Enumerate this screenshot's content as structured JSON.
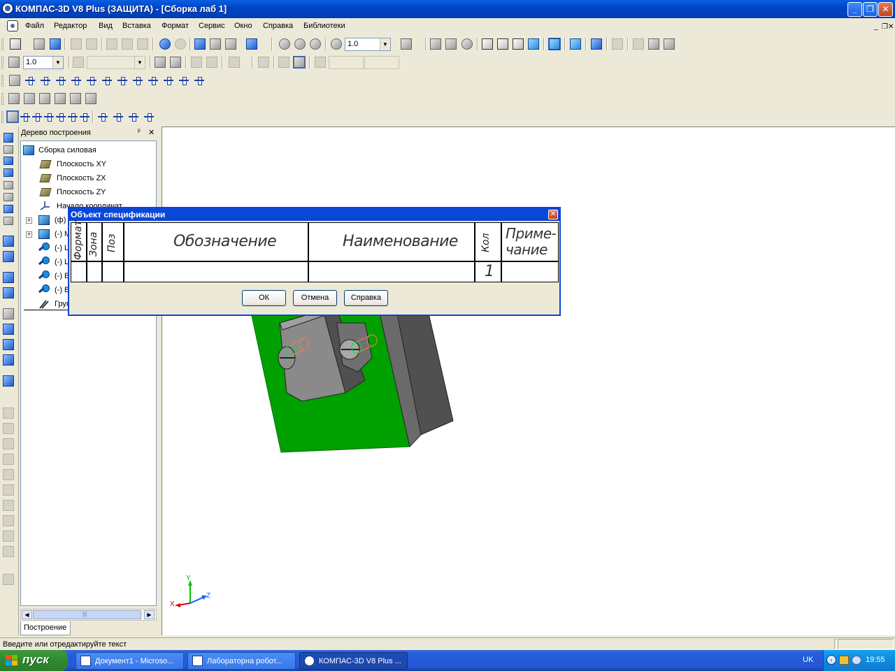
{
  "window": {
    "title": "КОМПАС-3D V8 Plus (ЗАЩИТА) - [Сборка лаб 1]",
    "minimize": "_",
    "restore": "❐",
    "close": "✕"
  },
  "menubar": {
    "items": [
      "Файл",
      "Редактор",
      "Вид",
      "Вставка",
      "Формат",
      "Сервис",
      "Окно",
      "Справка",
      "Библиотеки"
    ],
    "doc_controls": [
      "_",
      "❐",
      "✕"
    ]
  },
  "toolbar1": {
    "scale_value": "1.0"
  },
  "toolbar2": {
    "step_value": "1.0"
  },
  "tree": {
    "header": "Дерево построения",
    "pin": "ᵖ",
    "close": "✕",
    "root": "Сборка силовая",
    "items": [
      {
        "label": "Плоскость XY"
      },
      {
        "label": "Плоскость ZX"
      },
      {
        "label": "Плоскость ZY"
      },
      {
        "label": "Начало координат"
      },
      {
        "label": "(ф)"
      },
      {
        "label": "(-) М"
      },
      {
        "label": "(-) L"
      },
      {
        "label": "(-) L"
      },
      {
        "label": "(-) В"
      },
      {
        "label": "(-) В"
      },
      {
        "label": "Груп"
      }
    ],
    "expander": "+",
    "scroll_left": "◀",
    "scroll_right": "▶",
    "scroll_grip": "|||",
    "tab": "Построение"
  },
  "axes": {
    "x": "X",
    "y": "Y",
    "z": "Z"
  },
  "dialog": {
    "title": "Объект спецификации",
    "close": "✕",
    "columns": {
      "format": "Формат",
      "zone": "Зона",
      "pos": "Поз",
      "designation": "Обозначение",
      "name": "Наименование",
      "qty": "Кол",
      "note_line1": "Приме-",
      "note_line2": "чание"
    },
    "row": {
      "qty": "1"
    },
    "buttons": {
      "ok": "ОК",
      "cancel": "Отмена",
      "help": "Справка"
    }
  },
  "status": {
    "message": "Введите или отредактируйте текст"
  },
  "taskbar": {
    "start": "пуск",
    "tasks": [
      {
        "label": "Документ1 - Microso..."
      },
      {
        "label": "Лабораторна  робот..."
      },
      {
        "label": "КОМПАС-3D V8 Plus ..."
      }
    ],
    "lang": "UK",
    "clock": "19:55"
  },
  "colors": {
    "title_blue": "#0a46d8",
    "model_green": "#00a000",
    "model_gray": "#808080"
  }
}
